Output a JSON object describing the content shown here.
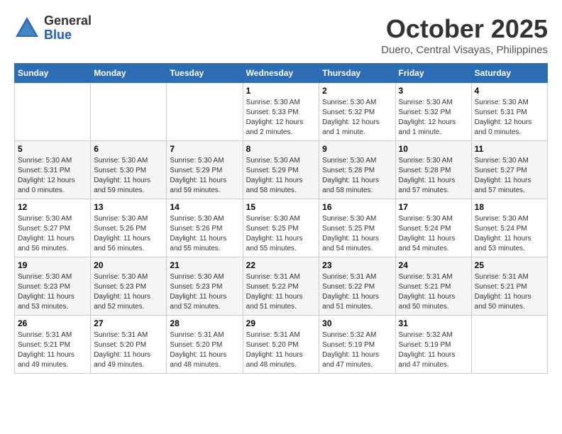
{
  "header": {
    "logo_general": "General",
    "logo_blue": "Blue",
    "month_title": "October 2025",
    "location": "Duero, Central Visayas, Philippines"
  },
  "days_of_week": [
    "Sunday",
    "Monday",
    "Tuesday",
    "Wednesday",
    "Thursday",
    "Friday",
    "Saturday"
  ],
  "weeks": [
    [
      {
        "day": "",
        "info": ""
      },
      {
        "day": "",
        "info": ""
      },
      {
        "day": "",
        "info": ""
      },
      {
        "day": "1",
        "info": "Sunrise: 5:30 AM\nSunset: 5:33 PM\nDaylight: 12 hours and 2 minutes."
      },
      {
        "day": "2",
        "info": "Sunrise: 5:30 AM\nSunset: 5:32 PM\nDaylight: 12 hours and 1 minute."
      },
      {
        "day": "3",
        "info": "Sunrise: 5:30 AM\nSunset: 5:32 PM\nDaylight: 12 hours and 1 minute."
      },
      {
        "day": "4",
        "info": "Sunrise: 5:30 AM\nSunset: 5:31 PM\nDaylight: 12 hours and 0 minutes."
      }
    ],
    [
      {
        "day": "5",
        "info": "Sunrise: 5:30 AM\nSunset: 5:31 PM\nDaylight: 12 hours and 0 minutes."
      },
      {
        "day": "6",
        "info": "Sunrise: 5:30 AM\nSunset: 5:30 PM\nDaylight: 11 hours and 59 minutes."
      },
      {
        "day": "7",
        "info": "Sunrise: 5:30 AM\nSunset: 5:29 PM\nDaylight: 11 hours and 59 minutes."
      },
      {
        "day": "8",
        "info": "Sunrise: 5:30 AM\nSunset: 5:29 PM\nDaylight: 11 hours and 58 minutes."
      },
      {
        "day": "9",
        "info": "Sunrise: 5:30 AM\nSunset: 5:28 PM\nDaylight: 11 hours and 58 minutes."
      },
      {
        "day": "10",
        "info": "Sunrise: 5:30 AM\nSunset: 5:28 PM\nDaylight: 11 hours and 57 minutes."
      },
      {
        "day": "11",
        "info": "Sunrise: 5:30 AM\nSunset: 5:27 PM\nDaylight: 11 hours and 57 minutes."
      }
    ],
    [
      {
        "day": "12",
        "info": "Sunrise: 5:30 AM\nSunset: 5:27 PM\nDaylight: 11 hours and 56 minutes."
      },
      {
        "day": "13",
        "info": "Sunrise: 5:30 AM\nSunset: 5:26 PM\nDaylight: 11 hours and 56 minutes."
      },
      {
        "day": "14",
        "info": "Sunrise: 5:30 AM\nSunset: 5:26 PM\nDaylight: 11 hours and 55 minutes."
      },
      {
        "day": "15",
        "info": "Sunrise: 5:30 AM\nSunset: 5:25 PM\nDaylight: 11 hours and 55 minutes."
      },
      {
        "day": "16",
        "info": "Sunrise: 5:30 AM\nSunset: 5:25 PM\nDaylight: 11 hours and 54 minutes."
      },
      {
        "day": "17",
        "info": "Sunrise: 5:30 AM\nSunset: 5:24 PM\nDaylight: 11 hours and 54 minutes."
      },
      {
        "day": "18",
        "info": "Sunrise: 5:30 AM\nSunset: 5:24 PM\nDaylight: 11 hours and 53 minutes."
      }
    ],
    [
      {
        "day": "19",
        "info": "Sunrise: 5:30 AM\nSunset: 5:23 PM\nDaylight: 11 hours and 53 minutes."
      },
      {
        "day": "20",
        "info": "Sunrise: 5:30 AM\nSunset: 5:23 PM\nDaylight: 11 hours and 52 minutes."
      },
      {
        "day": "21",
        "info": "Sunrise: 5:30 AM\nSunset: 5:23 PM\nDaylight: 11 hours and 52 minutes."
      },
      {
        "day": "22",
        "info": "Sunrise: 5:31 AM\nSunset: 5:22 PM\nDaylight: 11 hours and 51 minutes."
      },
      {
        "day": "23",
        "info": "Sunrise: 5:31 AM\nSunset: 5:22 PM\nDaylight: 11 hours and 51 minutes."
      },
      {
        "day": "24",
        "info": "Sunrise: 5:31 AM\nSunset: 5:21 PM\nDaylight: 11 hours and 50 minutes."
      },
      {
        "day": "25",
        "info": "Sunrise: 5:31 AM\nSunset: 5:21 PM\nDaylight: 11 hours and 50 minutes."
      }
    ],
    [
      {
        "day": "26",
        "info": "Sunrise: 5:31 AM\nSunset: 5:21 PM\nDaylight: 11 hours and 49 minutes."
      },
      {
        "day": "27",
        "info": "Sunrise: 5:31 AM\nSunset: 5:20 PM\nDaylight: 11 hours and 49 minutes."
      },
      {
        "day": "28",
        "info": "Sunrise: 5:31 AM\nSunset: 5:20 PM\nDaylight: 11 hours and 48 minutes."
      },
      {
        "day": "29",
        "info": "Sunrise: 5:31 AM\nSunset: 5:20 PM\nDaylight: 11 hours and 48 minutes."
      },
      {
        "day": "30",
        "info": "Sunrise: 5:32 AM\nSunset: 5:19 PM\nDaylight: 11 hours and 47 minutes."
      },
      {
        "day": "31",
        "info": "Sunrise: 5:32 AM\nSunset: 5:19 PM\nDaylight: 11 hours and 47 minutes."
      },
      {
        "day": "",
        "info": ""
      }
    ]
  ]
}
